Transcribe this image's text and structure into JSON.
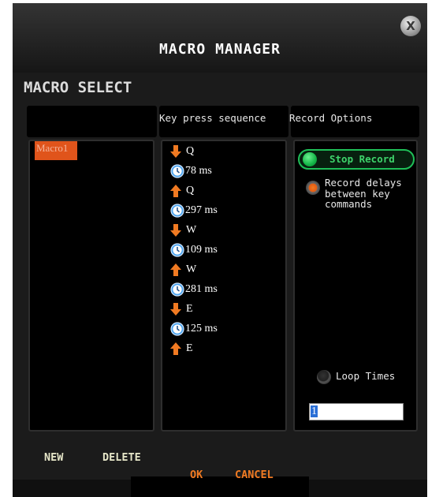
{
  "window": {
    "title": "MACRO MANAGER"
  },
  "section_title": "MACRO SELECT",
  "columns": {
    "macros": "",
    "sequence": "Key press sequence",
    "record": "Record Options"
  },
  "macros": {
    "items": [
      "Macro1"
    ],
    "selected": "Macro1"
  },
  "sequence": [
    {
      "kind": "key-down",
      "text": "Q"
    },
    {
      "kind": "delay",
      "text": "78 ms"
    },
    {
      "kind": "key-up",
      "text": "Q"
    },
    {
      "kind": "delay",
      "text": "297 ms"
    },
    {
      "kind": "key-down",
      "text": "W"
    },
    {
      "kind": "delay",
      "text": "109 ms"
    },
    {
      "kind": "key-up",
      "text": "W"
    },
    {
      "kind": "delay",
      "text": "281 ms"
    },
    {
      "kind": "key-down",
      "text": "E"
    },
    {
      "kind": "delay",
      "text": "125 ms"
    },
    {
      "kind": "key-up",
      "text": "E"
    }
  ],
  "record": {
    "stop_label": "Stop Record",
    "delay_label": "Record delays between key commands",
    "delay_checked": true,
    "loop_label": "Loop Times",
    "loop_checked": false,
    "loop_value": "1"
  },
  "buttons": {
    "new": "NEW",
    "delete": "DELETE",
    "ok": "OK",
    "cancel": "CANCEL"
  },
  "icons": {
    "key_down": "arrow-down-icon",
    "key_up": "arrow-up-icon",
    "delay": "clock-icon",
    "close": "close-icon"
  },
  "colors": {
    "accent": "#f07a22",
    "record_green": "#1fbf58",
    "selection": "#e0541b"
  }
}
